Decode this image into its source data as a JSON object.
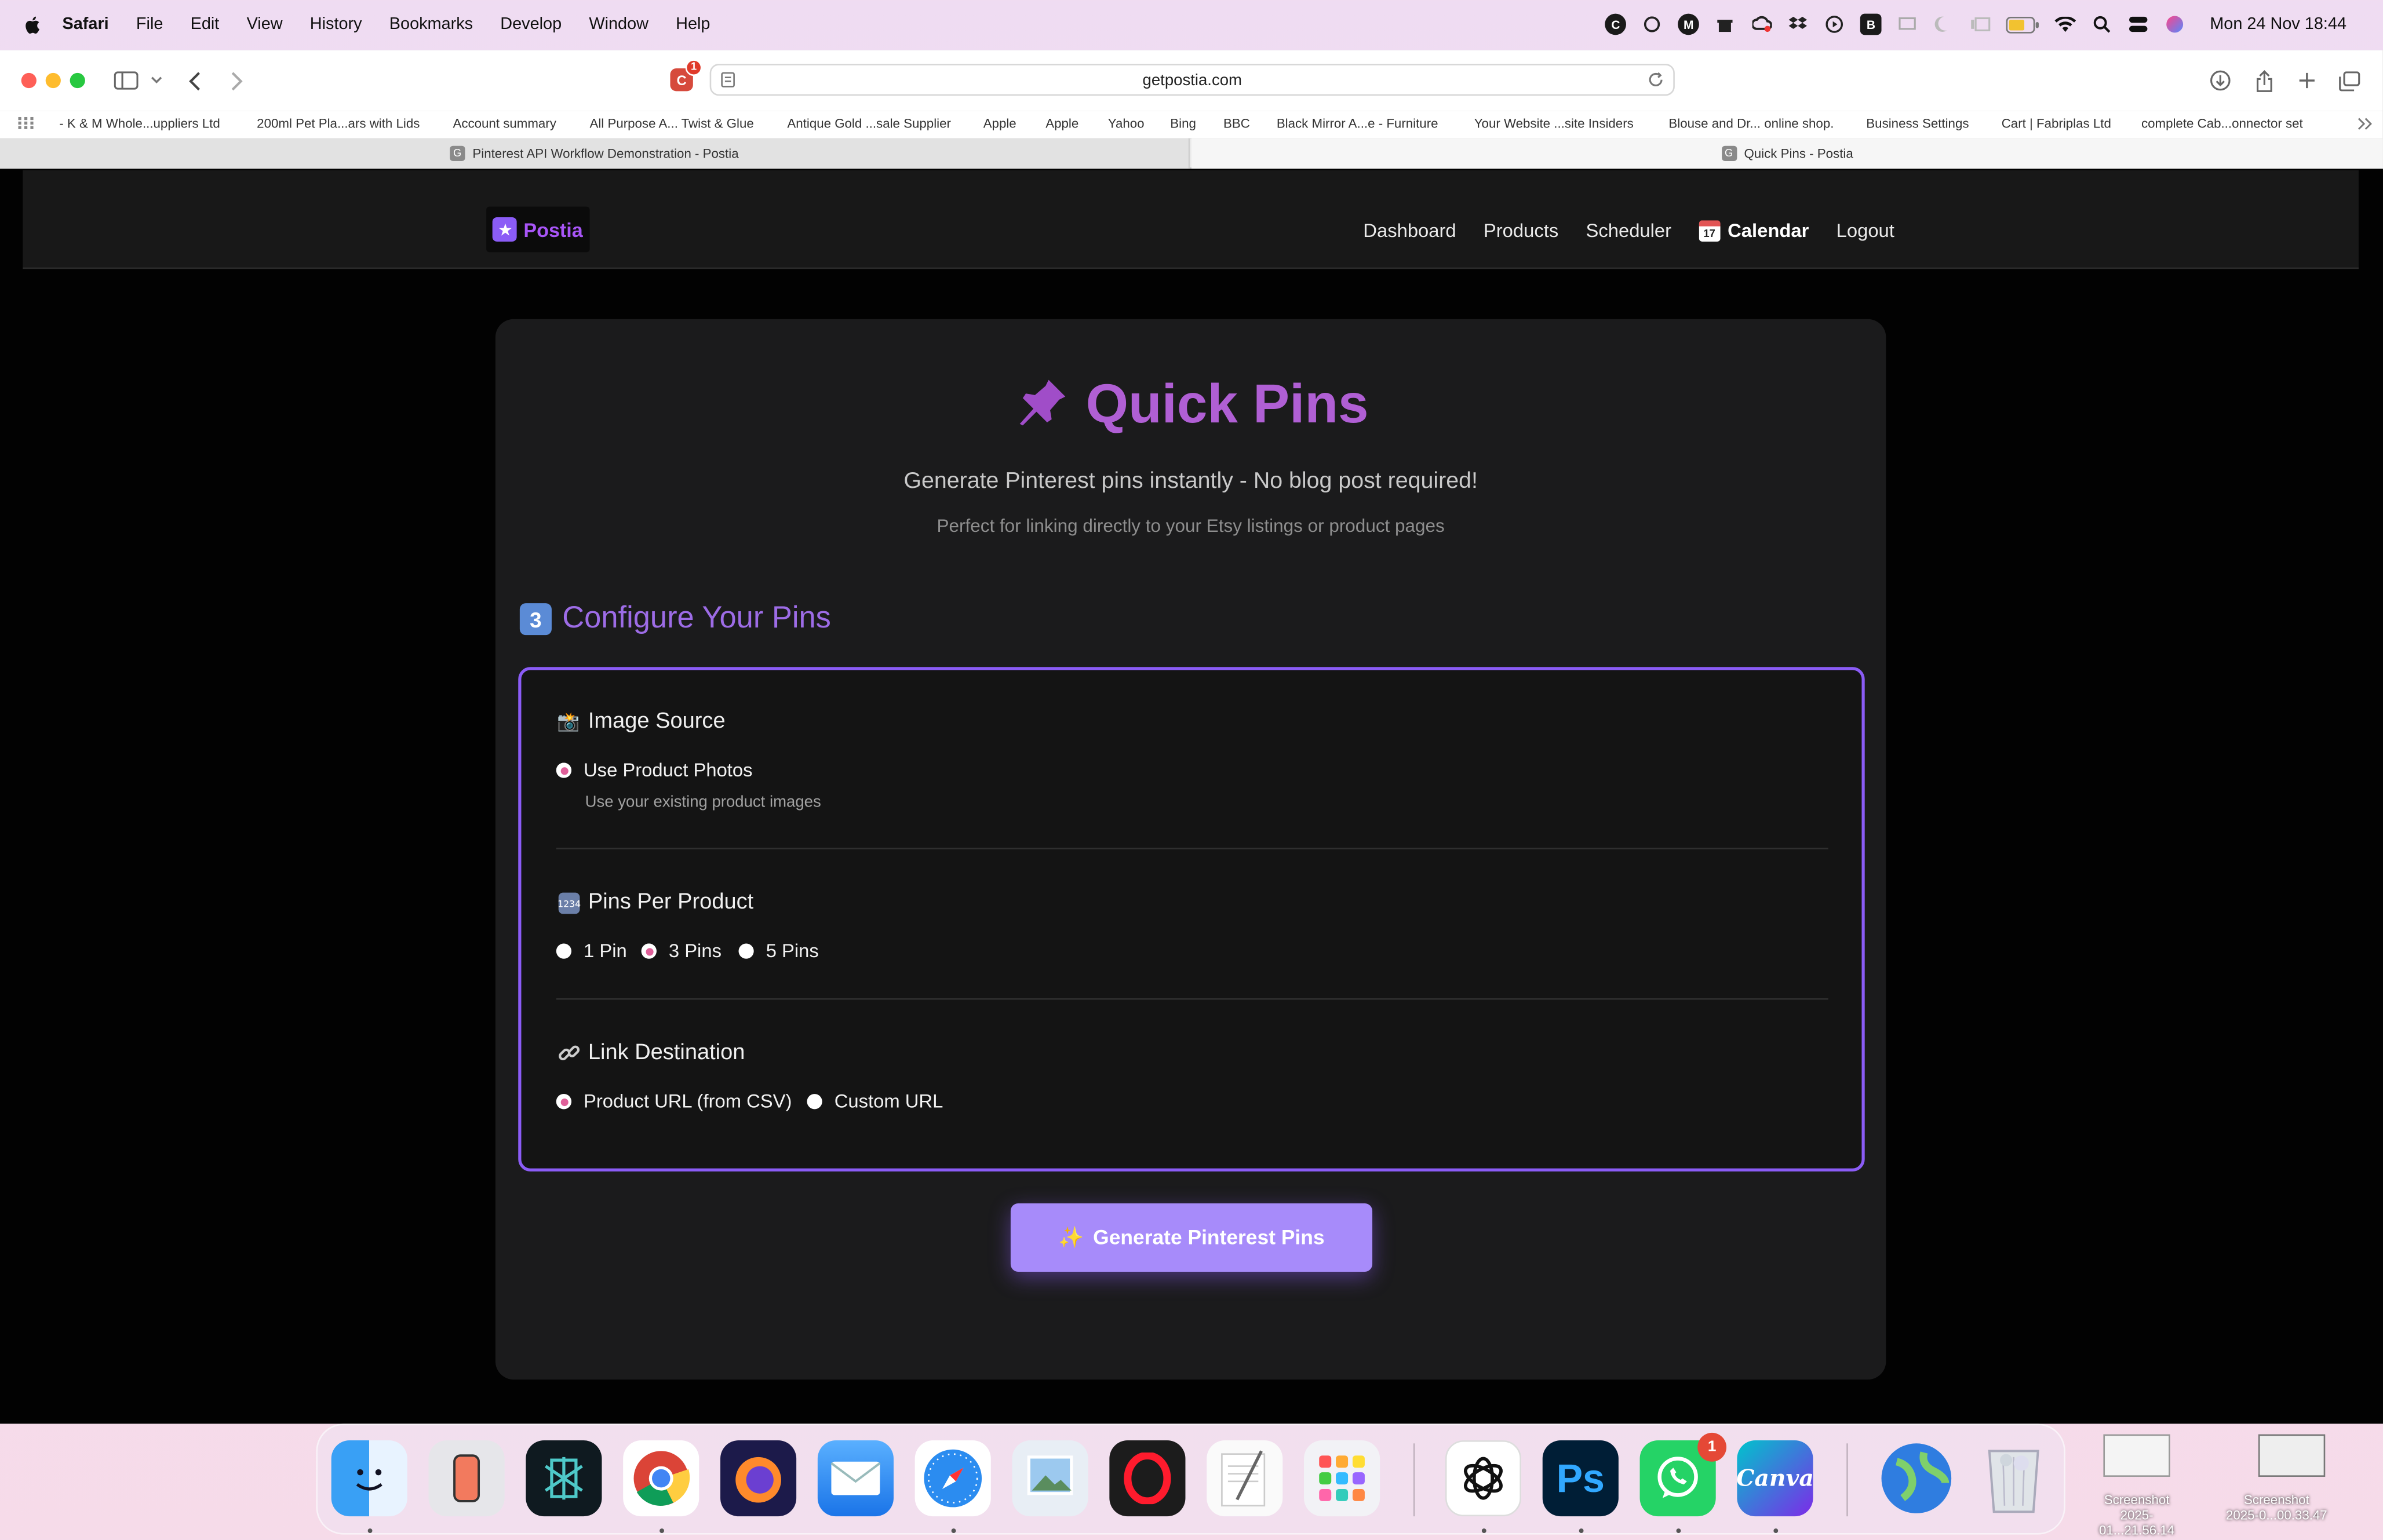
{
  "menubar": {
    "app_name": "Safari",
    "items": [
      "File",
      "Edit",
      "View",
      "History",
      "Bookmarks",
      "Develop",
      "Window",
      "Help"
    ],
    "clock": "Mon 24 Nov  18:44"
  },
  "browser": {
    "url": "getpostia.com",
    "extension_badge_count": "1",
    "bookmarks": [
      "- K & M Whole...uppliers Ltd",
      "200ml Pet Pla...ars with Lids",
      "Account summary",
      "All Purpose A... Twist & Glue",
      "Antique Gold ...sale Supplier",
      "Apple",
      "Apple",
      "Yahoo",
      "Bing",
      "BBC",
      "Black Mirror A...e - Furniture",
      "Your Website ...site Insiders",
      "Blouse and Dr... online shop.",
      "Business Settings",
      "Cart | Fabriplas Ltd",
      "complete Cab...onnector set"
    ],
    "tabs": [
      {
        "title": "Pinterest API Workflow Demonstration - Postia",
        "favicon": "G"
      },
      {
        "title": "Quick Pins - Postia",
        "favicon": "G"
      }
    ]
  },
  "nav": {
    "logo_text": "Postia",
    "links": {
      "dashboard": "Dashboard",
      "products": "Products",
      "scheduler": "Scheduler",
      "calendar": "Calendar",
      "calendar_icon_day": "17",
      "logout": "Logout"
    }
  },
  "hero": {
    "title": "Quick Pins",
    "subtitle": "Generate Pinterest pins instantly - No blog post required!",
    "description": "Perfect for linking directly to your Etsy listings or product pages"
  },
  "config": {
    "step_number": "3",
    "heading": "Configure Your Pins",
    "image_source": {
      "title": "Image Source",
      "option": "Use Product Photos",
      "hint": "Use your existing product images"
    },
    "pins_per_product": {
      "title": "Pins Per Product",
      "options": [
        "1 Pin",
        "3 Pins",
        "5 Pins"
      ],
      "selected": "3 Pins"
    },
    "link_destination": {
      "title": "Link Destination",
      "options": [
        "Product URL (from CSV)",
        "Custom URL"
      ],
      "selected": "Product URL (from CSV)"
    }
  },
  "generate_button": {
    "sparkle": "✨",
    "label": "Generate Pinterest Pins"
  },
  "dock": {
    "whatsapp_badge": "1",
    "canva_label": "Canva",
    "photoshop_label": "Ps"
  },
  "desktop_files": [
    "Screenshot\n2025-01...21.56.14",
    "Screenshot\n2025-0...00.33.47"
  ],
  "colors": {
    "accent_purple": "#8b5cf6",
    "title_purple": "#b05fd4",
    "button_purple": "#a78bfa",
    "radio_pink": "#e0609a",
    "page_bg": "#020202",
    "card_bg": "#1b1b1c"
  }
}
